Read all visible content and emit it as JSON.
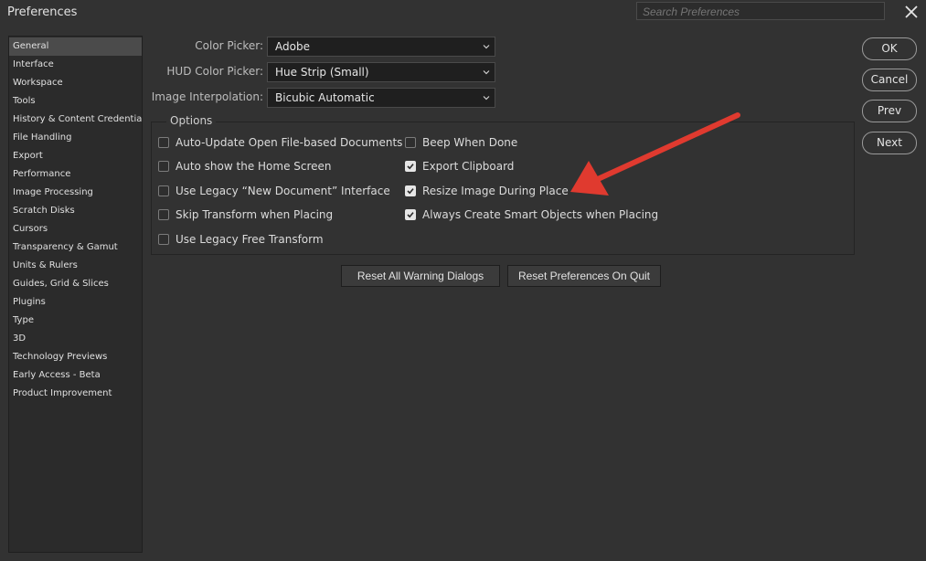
{
  "window": {
    "title": "Preferences",
    "search_placeholder": "Search Preferences"
  },
  "icons": {
    "close": "close-icon",
    "chevron": "chevron-down-icon",
    "check": "check-icon"
  },
  "colors": {
    "background": "#323232",
    "sidebar": "#2b2b2b",
    "active_item": "#4b4b4b",
    "arrow": "#e03a2f"
  },
  "sidebar": {
    "items": [
      "General",
      "Interface",
      "Workspace",
      "Tools",
      "History & Content Credentials",
      "File Handling",
      "Export",
      "Performance",
      "Image Processing",
      "Scratch Disks",
      "Cursors",
      "Transparency & Gamut",
      "Units & Rulers",
      "Guides, Grid & Slices",
      "Plugins",
      "Type",
      "3D",
      "Technology Previews",
      "Early Access - Beta",
      "Product Improvement"
    ],
    "selected": "General"
  },
  "fields": {
    "color_picker": {
      "label": "Color Picker:",
      "value": "Adobe"
    },
    "hud_color_picker": {
      "label": "HUD Color Picker:",
      "value": "Hue Strip (Small)"
    },
    "image_interpolation": {
      "label": "Image Interpolation:",
      "value": "Bicubic Automatic"
    }
  },
  "options": {
    "legend": "Options",
    "left": [
      {
        "label": "Auto-Update Open File-based Documents",
        "checked": false
      },
      {
        "label": "Auto show the Home Screen",
        "checked": false
      },
      {
        "label": "Use Legacy “New Document” Interface",
        "checked": false
      },
      {
        "label": "Skip Transform when Placing",
        "checked": false
      },
      {
        "label": "Use Legacy Free Transform",
        "checked": false
      }
    ],
    "right": [
      {
        "label": "Beep When Done",
        "checked": false
      },
      {
        "label": "Export Clipboard",
        "checked": true
      },
      {
        "label": "Resize Image During Place",
        "checked": true
      },
      {
        "label": "Always Create Smart Objects when Placing",
        "checked": true
      }
    ]
  },
  "buttons": {
    "reset_warnings": "Reset All Warning Dialogs",
    "reset_prefs": "Reset Preferences On Quit",
    "ok": "OK",
    "cancel": "Cancel",
    "prev": "Prev",
    "next": "Next"
  }
}
